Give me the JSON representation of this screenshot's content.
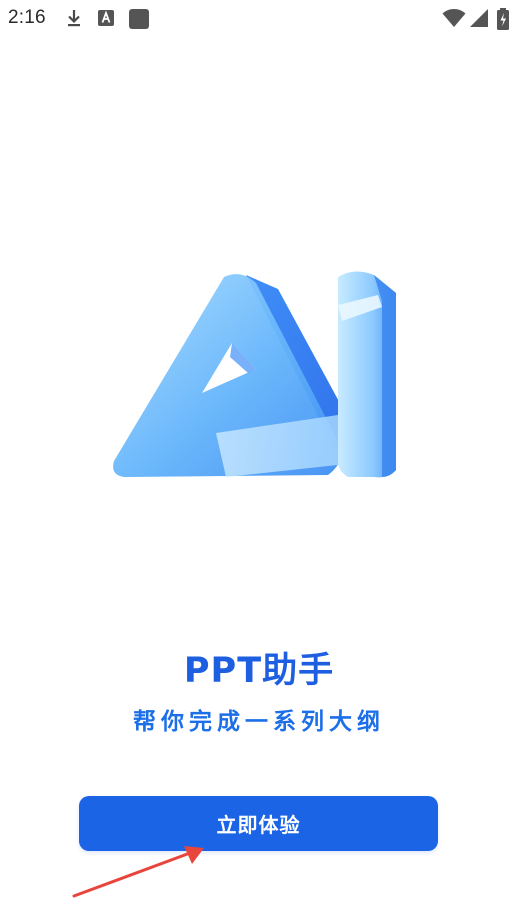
{
  "status_bar": {
    "time": "2:16",
    "icons": [
      "download-icon",
      "a-icon",
      "square-icon",
      "wifi-icon",
      "signal-icon",
      "battery-icon"
    ]
  },
  "logo": {
    "icon": "ai-logo"
  },
  "title": "PPT助手",
  "subtitle": "帮你完成一系列大纲",
  "cta": {
    "label": "立即体验"
  },
  "colors": {
    "accent": "#1c64e6",
    "title": "#1d5fe0",
    "subtitle": "#1d6fe8",
    "arrow": "#e8453c"
  }
}
